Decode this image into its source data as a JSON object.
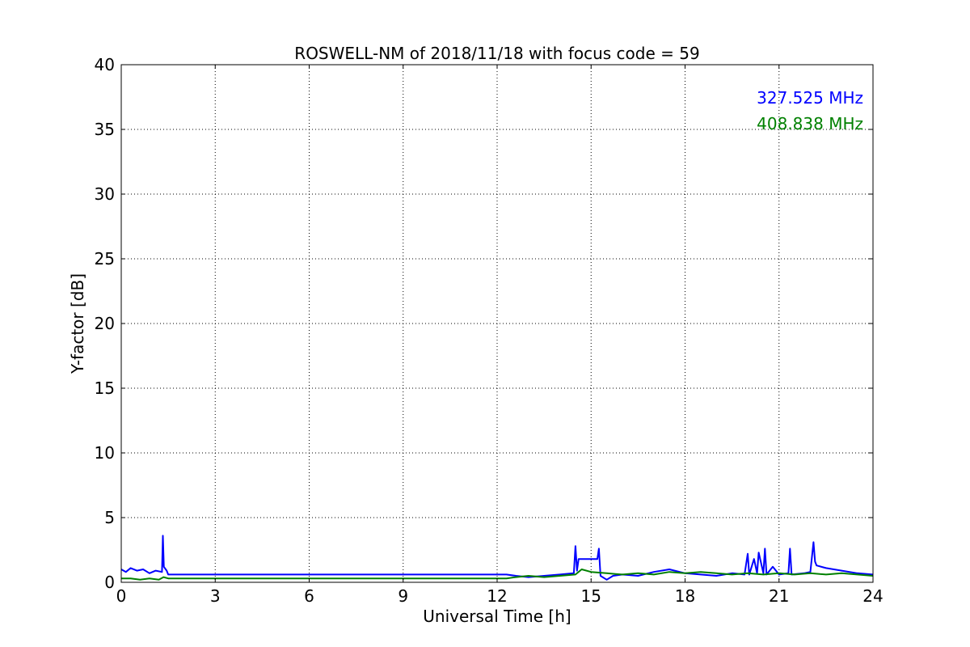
{
  "chart_data": {
    "type": "line",
    "title": "ROSWELL-NM of 2018/11/18 with focus code = 59",
    "xlabel": "Universal Time [h]",
    "ylabel": "Y-factor [dB]",
    "xlim": [
      0,
      24
    ],
    "ylim": [
      0,
      40
    ],
    "xticks": [
      0,
      3,
      6,
      9,
      12,
      15,
      18,
      21,
      24
    ],
    "yticks": [
      0,
      5,
      10,
      15,
      20,
      25,
      30,
      35,
      40
    ],
    "grid": true,
    "legend_placement": "top-right",
    "series": [
      {
        "name": "327.525 MHz",
        "color": "#0000ff",
        "x": [
          0,
          0.15,
          0.3,
          0.5,
          0.7,
          0.9,
          1.1,
          1.3,
          1.33,
          1.36,
          1.45,
          1.5,
          12.3,
          12.6,
          13.0,
          13.5,
          14.0,
          14.45,
          14.5,
          14.55,
          14.6,
          15.2,
          15.25,
          15.3,
          15.5,
          15.7,
          16.0,
          16.5,
          17.0,
          17.5,
          18.0,
          18.5,
          19.0,
          19.5,
          19.9,
          20.0,
          20.05,
          20.2,
          20.3,
          20.35,
          20.5,
          20.55,
          20.6,
          20.8,
          21.0,
          21.3,
          21.35,
          21.4,
          21.8,
          22.0,
          22.1,
          22.15,
          22.2,
          22.5,
          23.0,
          23.5,
          24.0
        ],
        "y": [
          1.0,
          0.8,
          1.1,
          0.9,
          1.0,
          0.7,
          0.9,
          0.8,
          3.6,
          1.2,
          0.9,
          0.6,
          0.6,
          0.5,
          0.4,
          0.5,
          0.6,
          0.7,
          2.8,
          0.9,
          1.8,
          1.8,
          2.6,
          0.5,
          0.2,
          0.5,
          0.6,
          0.5,
          0.8,
          1.0,
          0.7,
          0.6,
          0.5,
          0.7,
          0.6,
          2.2,
          0.6,
          1.8,
          0.7,
          2.3,
          0.7,
          2.6,
          0.6,
          1.2,
          0.6,
          0.7,
          2.6,
          0.6,
          0.7,
          0.8,
          3.1,
          1.6,
          1.3,
          1.1,
          0.9,
          0.7,
          0.6
        ]
      },
      {
        "name": "408.838 MHz",
        "color": "#008000",
        "x": [
          0,
          0.3,
          0.6,
          0.9,
          1.2,
          1.35,
          1.5,
          12.3,
          12.6,
          13.0,
          13.5,
          14.0,
          14.5,
          14.7,
          15.0,
          15.5,
          16.0,
          16.5,
          17.0,
          17.5,
          18.0,
          18.5,
          19.0,
          19.5,
          20.0,
          20.5,
          21.0,
          21.5,
          22.0,
          22.5,
          23.0,
          23.5,
          24.0
        ],
        "y": [
          0.3,
          0.3,
          0.2,
          0.3,
          0.2,
          0.4,
          0.3,
          0.3,
          0.4,
          0.5,
          0.4,
          0.5,
          0.6,
          1.0,
          0.8,
          0.7,
          0.6,
          0.7,
          0.6,
          0.8,
          0.7,
          0.8,
          0.7,
          0.6,
          0.7,
          0.6,
          0.7,
          0.6,
          0.7,
          0.6,
          0.7,
          0.6,
          0.5
        ]
      }
    ]
  }
}
